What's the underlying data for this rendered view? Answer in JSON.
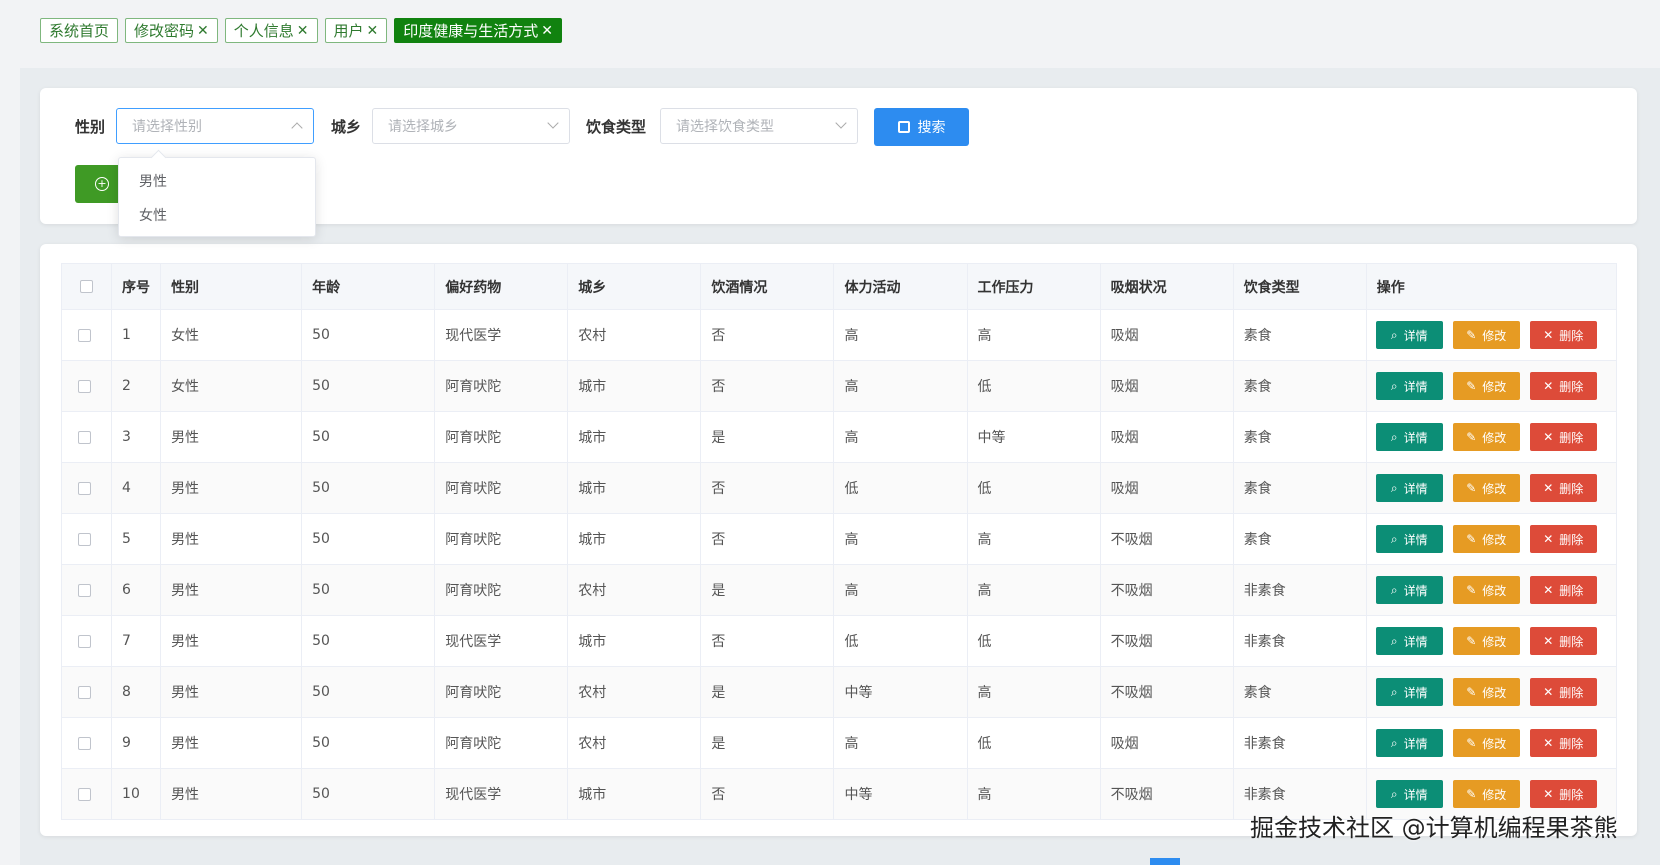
{
  "tabs": [
    {
      "label": "系统首页",
      "closable": false,
      "active": false
    },
    {
      "label": "修改密码",
      "closable": true,
      "active": false
    },
    {
      "label": "个人信息",
      "closable": true,
      "active": false
    },
    {
      "label": "用户",
      "closable": true,
      "active": false
    },
    {
      "label": "印度健康与生活方式",
      "closable": true,
      "active": true
    }
  ],
  "close_glyph": "✕",
  "search": {
    "gender_label": "性别",
    "gender_placeholder": "请选择性别",
    "region_label": "城乡",
    "region_placeholder": "请选择城乡",
    "diet_label": "饮食类型",
    "diet_placeholder": "请选择饮食类型",
    "search_button": "搜索",
    "gender_options": [
      "男性",
      "女性"
    ]
  },
  "table": {
    "headers": [
      "序号",
      "性别",
      "年龄",
      "偏好药物",
      "城乡",
      "饮酒情况",
      "体力活动",
      "工作压力",
      "吸烟状况",
      "饮食类型",
      "操作"
    ],
    "rows": [
      [
        "1",
        "女性",
        "50",
        "现代医学",
        "农村",
        "否",
        "高",
        "高",
        "吸烟",
        "素食"
      ],
      [
        "2",
        "女性",
        "50",
        "阿育吠陀",
        "城市",
        "否",
        "高",
        "低",
        "吸烟",
        "素食"
      ],
      [
        "3",
        "男性",
        "50",
        "阿育吠陀",
        "城市",
        "是",
        "高",
        "中等",
        "吸烟",
        "素食"
      ],
      [
        "4",
        "男性",
        "50",
        "阿育吠陀",
        "城市",
        "否",
        "低",
        "低",
        "吸烟",
        "素食"
      ],
      [
        "5",
        "男性",
        "50",
        "阿育吠陀",
        "城市",
        "否",
        "高",
        "高",
        "不吸烟",
        "素食"
      ],
      [
        "6",
        "男性",
        "50",
        "阿育吠陀",
        "农村",
        "是",
        "高",
        "高",
        "不吸烟",
        "非素食"
      ],
      [
        "7",
        "男性",
        "50",
        "现代医学",
        "城市",
        "否",
        "低",
        "低",
        "不吸烟",
        "非素食"
      ],
      [
        "8",
        "男性",
        "50",
        "阿育吠陀",
        "农村",
        "是",
        "中等",
        "高",
        "不吸烟",
        "素食"
      ],
      [
        "9",
        "男性",
        "50",
        "阿育吠陀",
        "农村",
        "是",
        "高",
        "低",
        "吸烟",
        "非素食"
      ],
      [
        "10",
        "男性",
        "50",
        "现代医学",
        "城市",
        "否",
        "中等",
        "高",
        "不吸烟",
        "非素食"
      ]
    ],
    "actions": {
      "detail": "详情",
      "edit": "修改",
      "delete": "删除"
    }
  },
  "colors": {
    "accent": "#2d8cf0",
    "tab_active": "#11820f",
    "detail": "#0c8e76",
    "edit": "#e69b23",
    "delete": "#dd4b39"
  },
  "watermark": "掘金技术社区 @计算机编程果茶熊"
}
